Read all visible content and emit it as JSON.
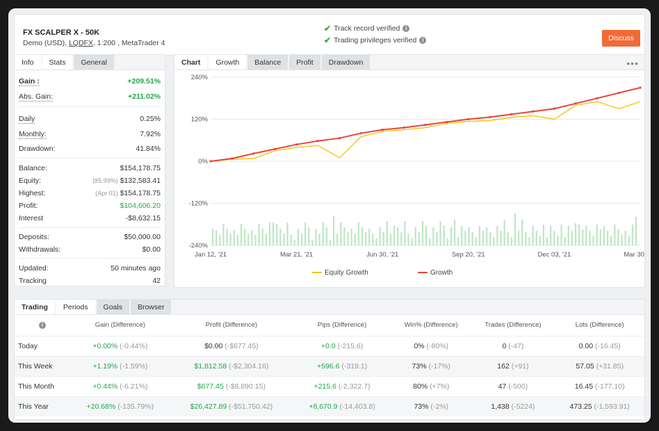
{
  "account": {
    "name": "FX SCALPER X - 50K",
    "sub_prefix": "Demo (USD), ",
    "broker": "LQDFX",
    "sub_suffix": ", 1:200 , MetaTrader 4"
  },
  "verification": {
    "track_record": "Track record verified",
    "privileges": "Trading privileges verified"
  },
  "discuss_label": "Discuss",
  "stats_tabs": [
    "Info",
    "Stats",
    "General"
  ],
  "stats": {
    "gain": {
      "label": "Gain :",
      "value": "+209.51%"
    },
    "abs_gain": {
      "label": "Abs. Gain:",
      "value": "+211.02%"
    },
    "daily": {
      "label": "Daily",
      "value": "0.25%"
    },
    "monthly": {
      "label": "Monthly:",
      "value": "7.92%"
    },
    "drawdown": {
      "label": "Drawdown:",
      "value": "41.84%"
    },
    "balance": {
      "label": "Balance:",
      "value": "$154,178.75"
    },
    "equity": {
      "label": "Equity:",
      "pct": "(85.99%)",
      "value": "$132,583.41"
    },
    "highest": {
      "label": "Highest:",
      "date": "(Apr 01)",
      "value": "$154,178.75"
    },
    "profit": {
      "label": "Profit:",
      "value": "$104,606.20"
    },
    "interest": {
      "label": "Interest",
      "value": "-$8,632.15"
    },
    "deposits": {
      "label": "Deposits:",
      "value": "$50,000.00"
    },
    "withdrawals": {
      "label": "Withdrawals:",
      "value": "$0.00"
    },
    "updated": {
      "label": "Updated:",
      "value": "50 minutes ago"
    },
    "tracking": {
      "label": "Tracking",
      "value": "42"
    }
  },
  "chart_tabs": [
    "Chart",
    "Growth",
    "Balance",
    "Profit",
    "Drawdown"
  ],
  "chart_data": {
    "type": "line",
    "y_ticks": [
      "240%",
      "120%",
      "0%",
      "-120%",
      "-240%"
    ],
    "ylim": [
      -240,
      240
    ],
    "x_ticks": [
      "Jan 12, '21",
      "Mar 21, '21",
      "Jun 30, '21",
      "Sep 20, '21",
      "Dec 03, '21",
      "Mar 30, '22"
    ],
    "legend": [
      "Equity Growth",
      "Growth"
    ],
    "colors": {
      "equity": "#f5c518",
      "growth": "#e8443a",
      "volume": "#bfe5c4"
    },
    "x_index": [
      0,
      1,
      2,
      3,
      4,
      5,
      6,
      7,
      8,
      9,
      10,
      11,
      12,
      13,
      14,
      15,
      16,
      17,
      18,
      19,
      20
    ],
    "series": [
      {
        "name": "Growth",
        "values": [
          0,
          8,
          22,
          35,
          48,
          58,
          66,
          80,
          90,
          96,
          104,
          112,
          120,
          126,
          134,
          142,
          150,
          165,
          180,
          195,
          210
        ]
      },
      {
        "name": "Equity Growth",
        "values": [
          0,
          6,
          8,
          30,
          40,
          45,
          10,
          70,
          85,
          90,
          96,
          108,
          114,
          116,
          125,
          130,
          120,
          160,
          170,
          150,
          170
        ]
      }
    ]
  },
  "period_tabs": [
    "Trading",
    "Periods",
    "Goals",
    "Browser"
  ],
  "periods": {
    "headers": [
      "",
      "Gain (Difference)",
      "Profit (Difference)",
      "Pips (Difference)",
      "Win% (Difference)",
      "Trades (Difference)",
      "Lots (Difference)"
    ],
    "rows": [
      {
        "label": "Today",
        "gain": "+0.00%",
        "gain_d": "(-0.44%)",
        "profit": "$0.00",
        "profit_d": "(-$677.45)",
        "pips": "+0.0",
        "pips_d": "(-215.6)",
        "win": "0%",
        "win_d": "(-80%)",
        "trades": "0",
        "trades_d": "(-47)",
        "lots": "0.00",
        "lots_d": "(-16.45)"
      },
      {
        "label": "This Week",
        "gain": "+1.19%",
        "gain_d": "(-1.59%)",
        "profit": "$1,812.58",
        "profit_d": "(-$2,304.16)",
        "pips": "+596.6",
        "pips_d": "(-319.1)",
        "win": "73%",
        "win_d": "(-17%)",
        "trades": "162",
        "trades_d": "(+91)",
        "lots": "57.05",
        "lots_d": "(+31.85)"
      },
      {
        "label": "This Month",
        "gain": "+0.44%",
        "gain_d": "(-6.21%)",
        "profit": "$677.45",
        "profit_d": "(-$8,890.15)",
        "pips": "+215.6",
        "pips_d": "(-2,322.7)",
        "win": "80%",
        "win_d": "(+7%)",
        "trades": "47",
        "trades_d": "(-500)",
        "lots": "16.45",
        "lots_d": "(-177.10)"
      },
      {
        "label": "This Year",
        "gain": "+20.68%",
        "gain_d": "(-135.79%)",
        "profit": "$26,427.89",
        "profit_d": "(-$51,750.42)",
        "pips": "+8,670.9",
        "pips_d": "(-14,403.8)",
        "win": "73%",
        "win_d": "(-2%)",
        "trades": "1,438",
        "trades_d": "(-5224)",
        "lots": "473.25",
        "lots_d": "(-1,593.91)"
      }
    ]
  }
}
